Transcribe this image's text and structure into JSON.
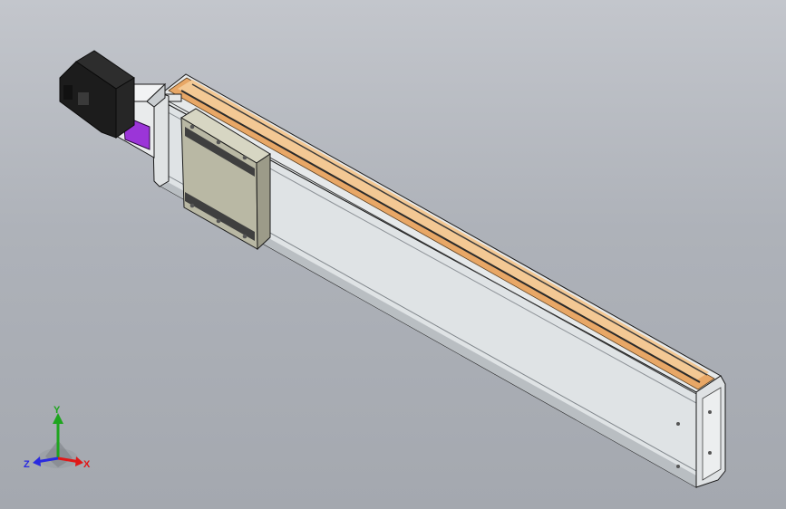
{
  "viewport": {
    "background_top": "#c3c6cc",
    "background_bottom": "#a4a8af"
  },
  "model": {
    "motor_color": "#1c1c1c",
    "coupling_color": "#e9ebec",
    "connector_color": "#9b35d8",
    "carriage_color": "#b9b8a4",
    "rail_color": "#dde2e4",
    "belt_color": "#e8a766"
  },
  "triad": {
    "x_label": "X",
    "y_label": "Y",
    "z_label": "Z",
    "x_color": "#e01818",
    "y_color": "#1ea51e",
    "z_color": "#2a2ae0"
  }
}
